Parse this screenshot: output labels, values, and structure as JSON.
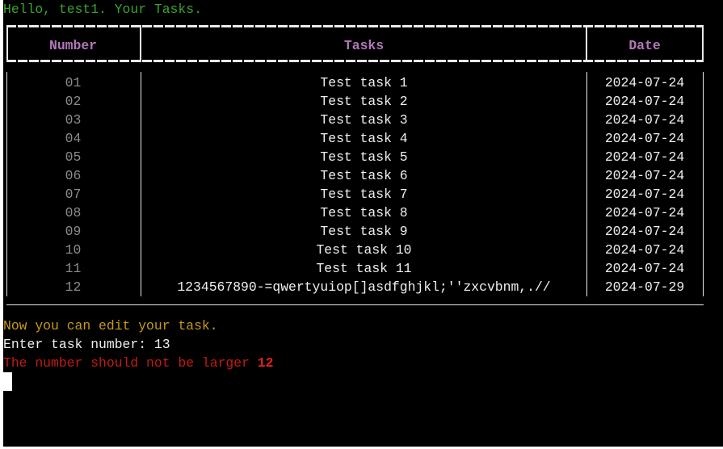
{
  "greeting": "Hello, test1. Your Tasks.",
  "table": {
    "headers": {
      "number": "Number",
      "tasks": "Tasks",
      "date": "Date"
    },
    "rows": [
      {
        "number": "01",
        "task": "Test task 1",
        "date": "2024-07-24"
      },
      {
        "number": "02",
        "task": "Test task 2",
        "date": "2024-07-24"
      },
      {
        "number": "03",
        "task": "Test task 3",
        "date": "2024-07-24"
      },
      {
        "number": "04",
        "task": "Test task 4",
        "date": "2024-07-24"
      },
      {
        "number": "05",
        "task": "Test task 5",
        "date": "2024-07-24"
      },
      {
        "number": "06",
        "task": "Test task 6",
        "date": "2024-07-24"
      },
      {
        "number": "07",
        "task": "Test task 7",
        "date": "2024-07-24"
      },
      {
        "number": "08",
        "task": "Test task 8",
        "date": "2024-07-24"
      },
      {
        "number": "09",
        "task": "Test task 9",
        "date": "2024-07-24"
      },
      {
        "number": "10",
        "task": "Test task 10",
        "date": "2024-07-24"
      },
      {
        "number": "11",
        "task": "Test task 11",
        "date": "2024-07-24"
      },
      {
        "number": "12",
        "task": "1234567890-=qwertyuiop[]asdfghjkl;''zxcvbnm,.//",
        "date": "2024-07-29"
      }
    ]
  },
  "prompts": {
    "edit": "Now you can edit your task.",
    "enter_label": "Enter task number: ",
    "enter_value": "13",
    "error_text": "The number should not be larger ",
    "error_value": "12"
  },
  "colors": {
    "background": "#000000",
    "greeting": "#3aa32e",
    "header": "#b277b8",
    "number_column": "#8c8c8c",
    "prompt": "#c69a16",
    "error": "#c11b17"
  }
}
